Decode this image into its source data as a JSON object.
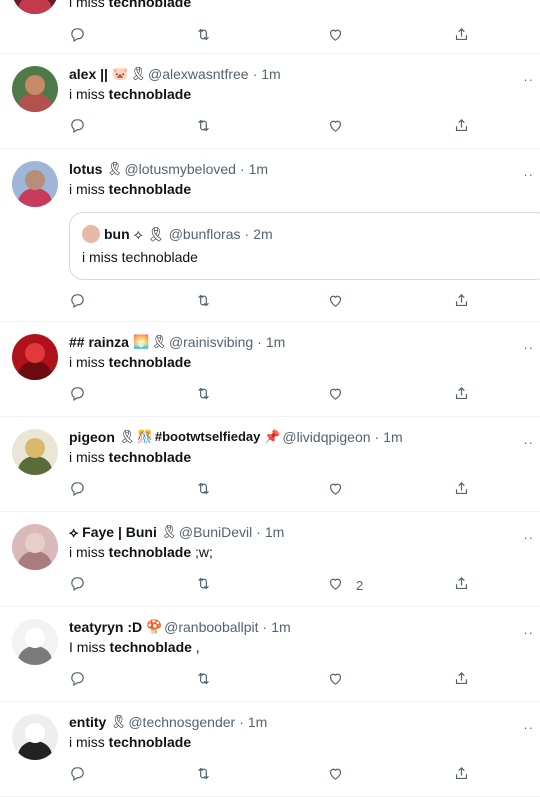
{
  "tweets": [
    {
      "name": "",
      "badges": [],
      "handle": "",
      "time": "",
      "text_pre": "i miss ",
      "text_bold": "technoblade",
      "text_post": "",
      "likes": "",
      "avatar_colors": [
        "#6a1a2a",
        "#1a1a1a",
        "#c33a4a"
      ]
    },
    {
      "name": "alex ||",
      "badges": [
        "🐷",
        "🎗"
      ],
      "handle": "@alexwasntfree",
      "time": "1m",
      "text_pre": "i miss ",
      "text_bold": "technoblade",
      "text_post": "",
      "likes": "",
      "avatar_colors": [
        "#4e7a4a",
        "#c68a66",
        "#b4514f"
      ]
    },
    {
      "name": "lotus",
      "badges": [
        "🎗"
      ],
      "handle": "@lotusmybeloved",
      "time": "1m",
      "text_pre": "i miss ",
      "text_bold": "technoblade",
      "text_post": "",
      "likes": "",
      "avatar_colors": [
        "#9fb6d8",
        "#b88e79",
        "#c93b5b"
      ],
      "quote": {
        "name": "bun",
        "badges": [
          "⟡",
          "🎗"
        ],
        "handle": "@bunfloras",
        "time": "2m",
        "text": "i miss technoblade"
      }
    },
    {
      "name": "## rainza",
      "badges": [
        "🌅",
        "🎗"
      ],
      "handle": "@rainisvibing",
      "time": "1m",
      "text_pre": "i miss ",
      "text_bold": "technoblade",
      "text_post": "",
      "likes": "",
      "avatar_colors": [
        "#b0121c",
        "#e03a3a",
        "#6b0b10"
      ]
    },
    {
      "name": "pigeon",
      "badges": [
        "🎗",
        "🎊",
        "#bootwtselfieday",
        "📌"
      ],
      "handle": "@lividqpigeon",
      "time": "1m",
      "text_pre": "i miss ",
      "text_bold": "technoblade",
      "text_post": "",
      "likes": "",
      "avatar_colors": [
        "#e9e6d8",
        "#d8b86a",
        "#5b6b3a"
      ]
    },
    {
      "name": "⟡ Faye | Buni",
      "badges": [
        "🎗"
      ],
      "handle": "@BuniDevil",
      "time": "1m",
      "text_pre": "i miss ",
      "text_bold": "technoblade",
      "text_post": " ;w;",
      "likes": "2",
      "avatar_colors": [
        "#d9b9b9",
        "#e6cfc8",
        "#a87d7d"
      ]
    },
    {
      "name": "teatyryn :D",
      "badges": [
        "🍄"
      ],
      "handle": "@ranbooballpit",
      "time": "1m",
      "text_pre": "I miss ",
      "text_bold": "technoblade",
      "text_post": " ,",
      "likes": "",
      "avatar_colors": [
        "#f3f3f3",
        "#ffffff",
        "#7a7a7a"
      ]
    },
    {
      "name": "entity",
      "badges": [
        "🎗"
      ],
      "handle": "@technosgender",
      "time": "1m",
      "text_pre": "i miss ",
      "text_bold": "technoblade",
      "text_post": "",
      "likes": "",
      "avatar_colors": [
        "#eeeeee",
        "#ffffff",
        "#222222"
      ]
    }
  ],
  "accent": "#536471"
}
